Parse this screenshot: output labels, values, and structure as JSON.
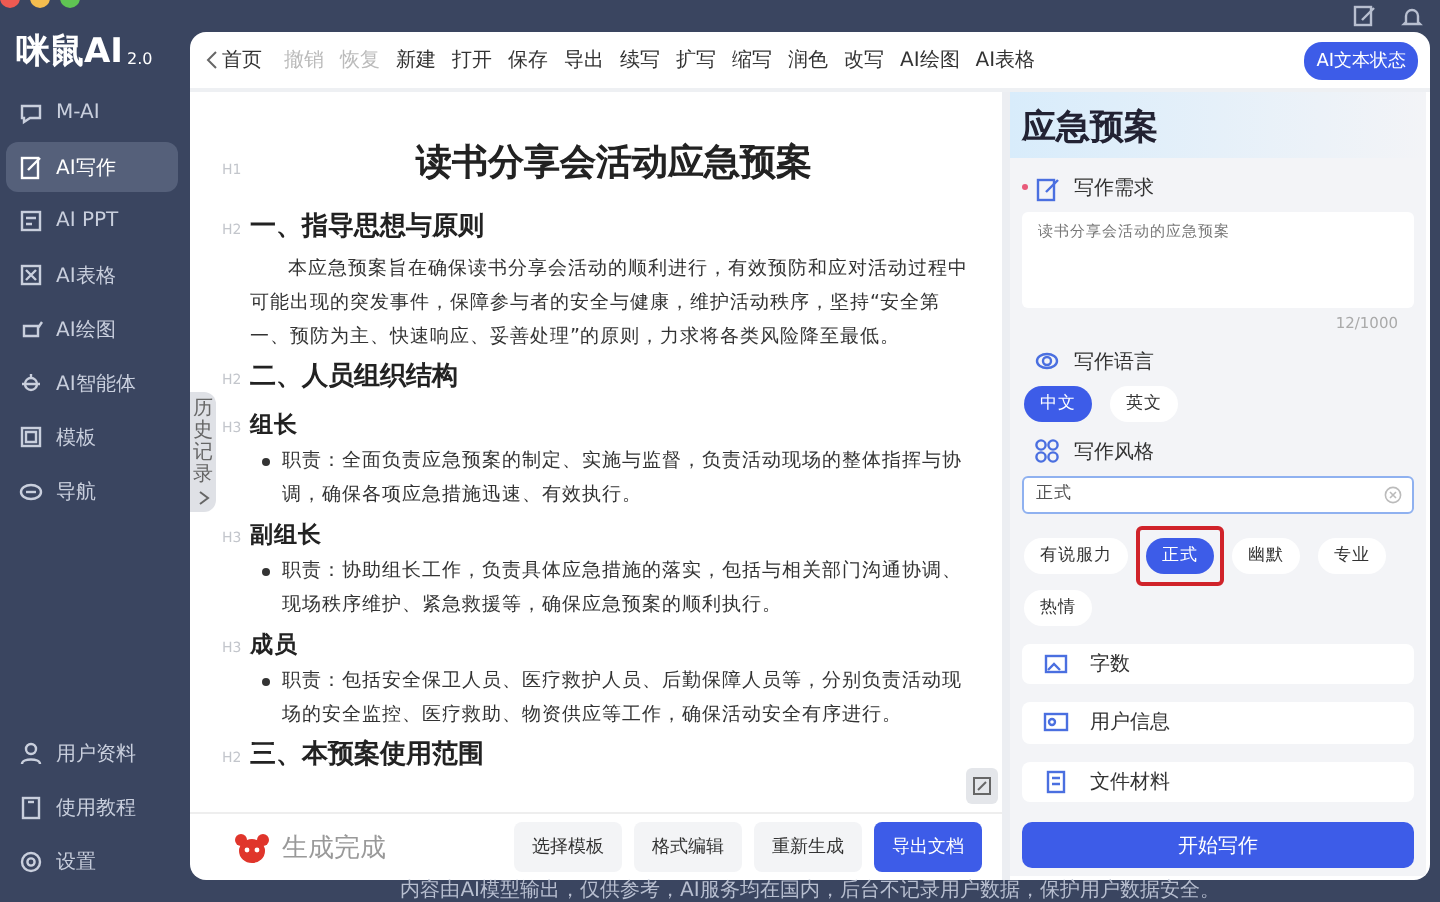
{
  "logo": {
    "name": "咪鼠AI",
    "version": "2.0"
  },
  "sidebar": {
    "items": [
      {
        "label": "M-AI",
        "selected": false
      },
      {
        "label": "AI写作",
        "selected": true
      },
      {
        "label": "AI PPT",
        "selected": false
      },
      {
        "label": "AI表格",
        "selected": false
      },
      {
        "label": "AI绘图",
        "selected": false
      },
      {
        "label": "AI智能体",
        "selected": false
      },
      {
        "label": "模板",
        "selected": false
      },
      {
        "label": "导航",
        "selected": false
      }
    ],
    "bottom_items": [
      {
        "label": "用户资料"
      },
      {
        "label": "使用教程"
      },
      {
        "label": "设置"
      }
    ]
  },
  "toolbar": {
    "back": "首页",
    "items": [
      {
        "label": "撤销",
        "disabled": true
      },
      {
        "label": "恢复",
        "disabled": true
      },
      {
        "label": "新建",
        "disabled": false
      },
      {
        "label": "打开",
        "disabled": false
      },
      {
        "label": "保存",
        "disabled": false
      },
      {
        "label": "导出",
        "disabled": false
      },
      {
        "label": "续写",
        "disabled": false
      },
      {
        "label": "扩写",
        "disabled": false
      },
      {
        "label": "缩写",
        "disabled": false
      },
      {
        "label": "润色",
        "disabled": false
      },
      {
        "label": "改写",
        "disabled": false
      },
      {
        "label": "AI绘图",
        "disabled": false
      },
      {
        "label": "AI表格",
        "disabled": false
      }
    ],
    "status_button": "AI文本状态"
  },
  "history_tab": {
    "label": "历史记录"
  },
  "document": {
    "blocks": [
      {
        "kind": "title",
        "tag": "H1",
        "text": "读书分享会活动应急预案"
      },
      {
        "kind": "heading",
        "tag": "H2",
        "text": "一、指导思想与原则"
      },
      {
        "kind": "paragraph",
        "text": "本应急预案旨在确保读书分享会活动的顺利进行，有效预防和应对活动过程中可能出现的突发事件，保障参与者的安全与健康，维护活动秩序，坚持“安全第一、预防为主、快速响应、妥善处理”的原则，力求将各类风险降至最低。"
      },
      {
        "kind": "heading",
        "tag": "H2",
        "text": "二、人员组织结构"
      },
      {
        "kind": "subheading",
        "tag": "H3",
        "text": "组长"
      },
      {
        "kind": "bullet",
        "text": "职责：全面负责应急预案的制定、实施与监督，负责活动现场的整体指挥与协调，确保各项应急措施迅速、有效执行。"
      },
      {
        "kind": "subheading",
        "tag": "H3",
        "text": "副组长"
      },
      {
        "kind": "bullet",
        "text": "职责：协助组长工作，负责具体应急措施的落实，包括与相关部门沟通协调、现场秩序维护、紧急救援等，确保应急预案的顺利执行。"
      },
      {
        "kind": "subheading",
        "tag": "H3",
        "text": "成员"
      },
      {
        "kind": "bullet",
        "text": "职责：包括安全保卫人员、医疗救护人员、后勤保障人员等，分别负责活动现场的安全监控、医疗救助、物资供应等工作，确保活动安全有序进行。"
      },
      {
        "kind": "heading",
        "tag": "H2",
        "text": "三、本预案使用范围"
      }
    ]
  },
  "bottom_bar": {
    "status": "生成完成",
    "buttons": [
      {
        "label": "选择模板",
        "primary": false
      },
      {
        "label": "格式编辑",
        "primary": false
      },
      {
        "label": "重新生成",
        "primary": false
      },
      {
        "label": "导出文档",
        "primary": true
      }
    ]
  },
  "panel": {
    "title": "应急预案",
    "requirement": {
      "label": "写作需求",
      "required": true,
      "value": "读书分享会活动的应急预案",
      "count": "12/1000"
    },
    "language": {
      "label": "写作语言",
      "options": [
        {
          "label": "中文",
          "selected": true
        },
        {
          "label": "英文",
          "selected": false
        }
      ]
    },
    "style": {
      "label": "写作风格",
      "value": "正式",
      "options": [
        {
          "label": "有说服力",
          "selected": false,
          "highlighted": false
        },
        {
          "label": "正式",
          "selected": true,
          "highlighted": true
        },
        {
          "label": "幽默",
          "selected": false,
          "highlighted": false
        },
        {
          "label": "专业",
          "selected": false,
          "highlighted": false
        },
        {
          "label": "热情",
          "selected": false,
          "highlighted": false
        }
      ]
    },
    "sections": [
      {
        "label": "字数"
      },
      {
        "label": "用户信息"
      },
      {
        "label": "文件材料"
      }
    ],
    "start_button": "开始写作"
  },
  "footer": "内容由AI模型输出，仅供参考，AI服务均在国内，后台不记录用户数据，保护用户数据安全。"
}
